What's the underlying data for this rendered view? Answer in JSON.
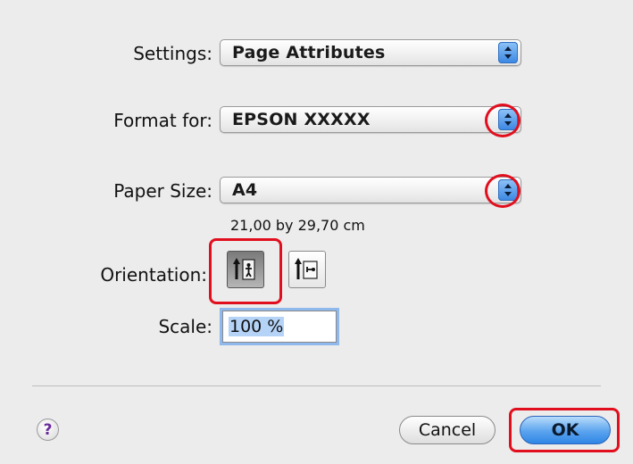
{
  "settings": {
    "label": "Settings:",
    "value": "Page Attributes"
  },
  "format_for": {
    "label": "Format for:",
    "value": "EPSON XXXXX"
  },
  "paper_size": {
    "label": "Paper Size:",
    "value": "A4",
    "dimensions": "21,00 by 29,70 cm"
  },
  "orientation": {
    "label": "Orientation:",
    "selected": "portrait",
    "options": [
      "portrait",
      "landscape"
    ]
  },
  "scale": {
    "label": "Scale:",
    "value": "100 %"
  },
  "buttons": {
    "help": "?",
    "cancel": "Cancel",
    "ok": "OK"
  },
  "colors": {
    "highlight_marker": "#e10f1e",
    "accent": "#3a86e3",
    "background": "#ececec"
  },
  "icons": [
    "popup-arrows-icon",
    "portrait-orientation-icon",
    "landscape-orientation-icon",
    "help-icon"
  ]
}
